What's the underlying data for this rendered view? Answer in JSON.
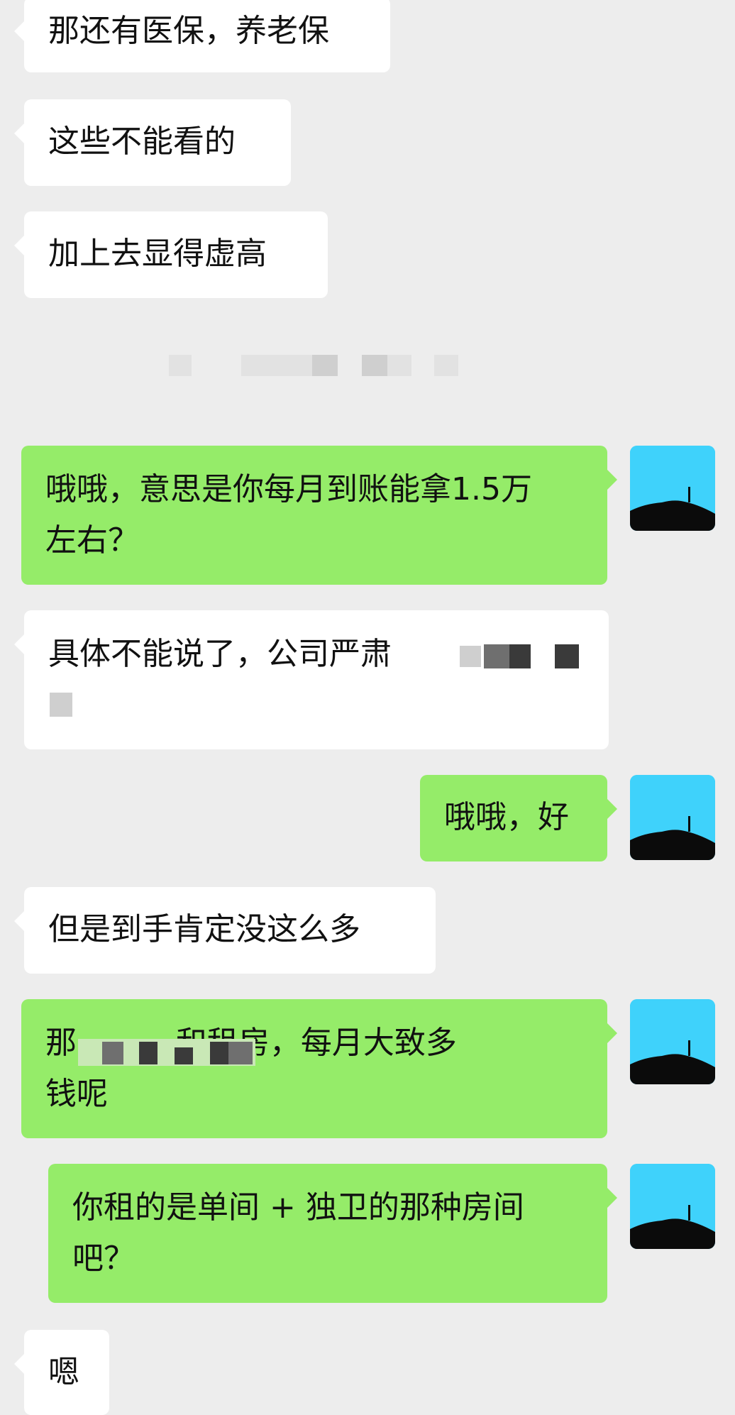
{
  "messages": [
    {
      "side": "in",
      "text": "那还有医保，养老保"
    },
    {
      "side": "in",
      "text": "这些不能看的"
    },
    {
      "side": "in",
      "text": "加上去显得虚高"
    },
    {
      "side": "out",
      "text": "哦哦，意思是你每月到账能拿1.5万\n左右？"
    },
    {
      "side": "in",
      "text": "具体不能说了，公司严肃"
    },
    {
      "side": "out",
      "text": "哦哦，好"
    },
    {
      "side": "in",
      "text": "但是到手肯定没这么多"
    },
    {
      "side": "out",
      "text": "那          和租房，每月大致多\n钱呢"
    },
    {
      "side": "out",
      "text": "你租的是单间 + 独卫的那种房间\n吧？"
    },
    {
      "side": "in",
      "text": "嗯"
    }
  ],
  "avatar": {
    "icon": "landscape-avatar-icon",
    "sky_color": "#3fd2fb"
  },
  "colors": {
    "incoming_bubble": "#ffffff",
    "outgoing_bubble": "#95ec69",
    "background": "#ededed"
  }
}
